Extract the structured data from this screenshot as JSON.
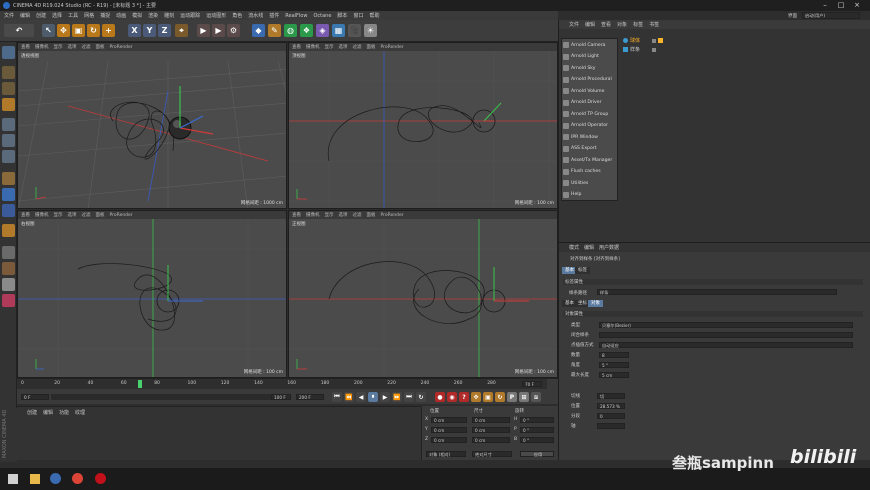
{
  "window": {
    "title": "CINEMA 4D R19.024 Studio (RC - R19) - [未标题 3 *] - 主要"
  },
  "menubar": [
    "文件",
    "编辑",
    "创建",
    "选择",
    "工具",
    "网格",
    "捕捉",
    "动画",
    "模拟",
    "渲染",
    "雕刻",
    "运动跟踪",
    "运动图形",
    "角色",
    "流水线",
    "插件",
    "RealFlow",
    "Octane",
    "脚本",
    "窗口",
    "帮助"
  ],
  "layout": {
    "label": "界面",
    "value": "启动(用户)"
  },
  "viewport_menu": [
    "查看",
    "摄像机",
    "显示",
    "选项",
    "过滤",
    "面板",
    "ProRender"
  ],
  "viewports": [
    {
      "name": "透视视图",
      "footer": "网格间距 : 1000 cm"
    },
    {
      "name": "顶视图",
      "footer": "网格间距 : 100 cm"
    },
    {
      "name": "右视图",
      "footer": "网格间距 : 100 cm"
    },
    {
      "name": "正视图",
      "footer": "网格间距 : 100 cm"
    }
  ],
  "timeline": {
    "ticks": [
      "0",
      "20",
      "40",
      "60",
      "80",
      "100",
      "120",
      "140",
      "160",
      "180",
      "200",
      "220",
      "240",
      "260",
      "280"
    ],
    "current_field": "0 F",
    "end_field": "100 F",
    "end_field2": "200 F",
    "frame_end": "72 F",
    "frame_label": "70 F",
    "playhead_frame": "72"
  },
  "material_menu": [
    "创建",
    "编辑",
    "功能",
    "纹理"
  ],
  "coords": {
    "headers": [
      "位置",
      "尺寸",
      "旋转"
    ],
    "rows": [
      {
        "axis": "X",
        "pos": "0 cm",
        "size": "0 cm",
        "rot_axis": "H",
        "rot": "0 °"
      },
      {
        "axis": "Y",
        "pos": "0 cm",
        "size": "0 cm",
        "rot_axis": "P",
        "rot": "0 °"
      },
      {
        "axis": "Z",
        "pos": "0 cm",
        "size": "0 cm",
        "rot_axis": "B",
        "rot": "0 °"
      }
    ],
    "mode": "对象 (相对)",
    "size_mode": "绝对尺寸",
    "apply": "应用"
  },
  "object_manager": {
    "menu": [
      "文件",
      "编辑",
      "查看",
      "对象",
      "标签",
      "书签"
    ],
    "objects": [
      "球体",
      "样条"
    ]
  },
  "plugin_menu": [
    "Arnold Camera",
    "Arnold Light",
    "Arnold Sky",
    "Arnold Procedural",
    "Arnold Volume",
    "Arnold Driver",
    "Arnold TP Group",
    "Arnold Operator",
    "IPR Window",
    "ASS Export",
    "Asset/Tx Manager",
    "Flush caches",
    "Utilities",
    "Help"
  ],
  "attributes": {
    "menu": [
      "模式",
      "编辑",
      "用户数据"
    ],
    "title": "对齐到样条 [对齐到样条]",
    "tabs1": [
      "基本",
      "标签"
    ],
    "section1": "标签属性",
    "spline_path_label": "样条路径",
    "spline_path_value": "样条",
    "tabs2": [
      "基本",
      "坐标",
      "对象"
    ],
    "section2": "对象属性",
    "rows": [
      {
        "label": "类型",
        "value": "贝塞尔(Bezier)"
      },
      {
        "label": "闭合样条",
        "value": ""
      },
      {
        "label": "点插值方式",
        "value": "自动适应"
      },
      {
        "label": "数量",
        "value": "8"
      },
      {
        "label": "角度",
        "value": "5 °"
      },
      {
        "label": "最大长度",
        "value": "5 cm"
      }
    ],
    "extra_rows": [
      {
        "label": "切线",
        "value": "切"
      },
      {
        "label": "位置",
        "value": "28.573 %"
      },
      {
        "label": "分段",
        "value": "0"
      },
      {
        "label": "轴",
        "value": ""
      }
    ]
  },
  "maxon": "MAXON CINEMA 4D",
  "watermark": "叁瓶sampinn",
  "bilibili": "bilibili",
  "colors": {
    "accent": "#5b7aa0",
    "x_axis": "#d23a3a",
    "y_axis": "#3ac24a",
    "z_axis": "#3a6ad2"
  }
}
